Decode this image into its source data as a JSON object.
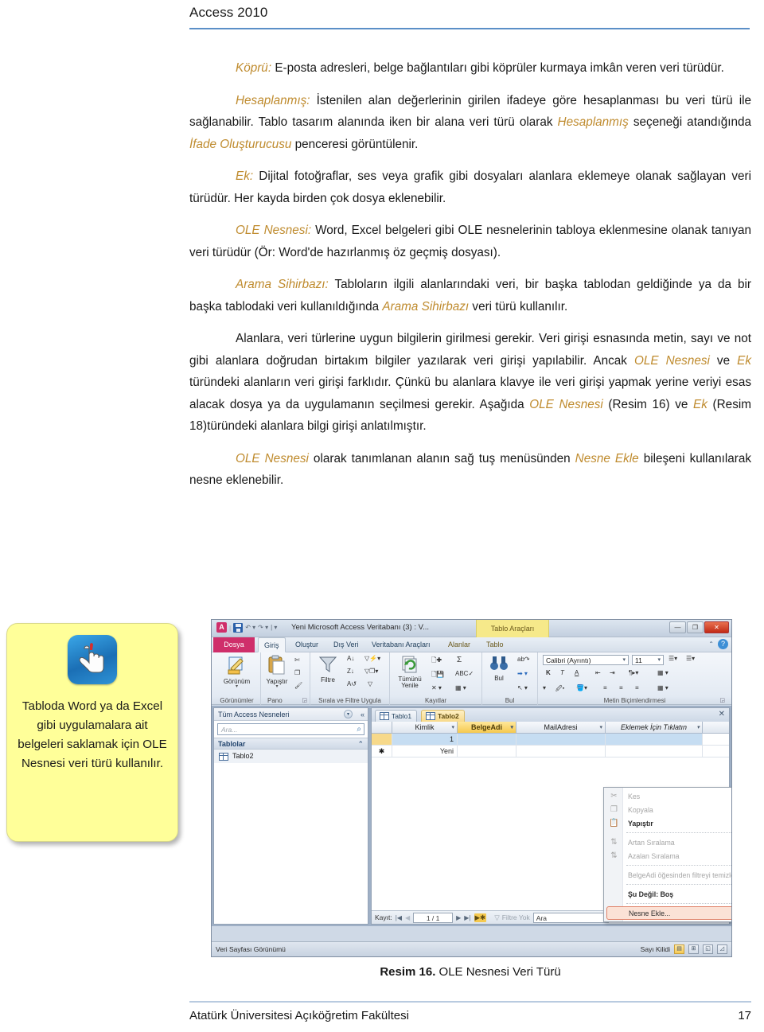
{
  "header": {
    "title": "Access 2010"
  },
  "colors": {
    "accent_text": "#bf8b2e",
    "rule": "#5b8fc7",
    "callout_bg": "#ffff99",
    "ribbon_file": "#cf2e6a",
    "context_tab": "#f6e98a"
  },
  "body_paragraphs": [
    {
      "lead": "Köprü:",
      "lead_style": "italic",
      "text": " E-posta adresleri, belge bağlantıları gibi köprüler kurmaya imkân veren veri türüdür."
    },
    {
      "lead": "Hesaplanmış:",
      "lead_style": "italic",
      "text": " İstenilen alan değerlerinin girilen ifadeye göre hesaplanması bu veri türü ile sağlanabilir. Tablo tasarım alanında iken bir alana veri türü olarak ",
      "mid1": "Hesaplanmış",
      "mid1_tail": " seçeneği atandığında ",
      "mid2": "İfade Oluşturucusu",
      "tail": " penceresi görüntülenir."
    },
    {
      "lead": "Ek:",
      "text": " Dijital fotoğraflar, ses veya grafik gibi dosyaları alanlara eklemeye olanak sağlayan veri türüdür. Her kayda birden çok dosya eklenebilir."
    },
    {
      "lead": "OLE Nesnesi:",
      "text": " Word, Excel belgeleri gibi OLE nesnelerinin tabloya eklenmesine olanak tanıyan veri türüdür (Ör: Word'de hazırlanmış öz geçmiş dosyası)."
    },
    {
      "lead": "Arama Sihirbazı:",
      "text": " Tabloların ilgili alanlarındaki veri, bir başka tablodan geldiğinde ya da bir başka tablodaki veri kullanıldığında ",
      "mid1": "Arama Sihirbazı",
      "tail": " veri türü kullanılır."
    }
  ],
  "paragraph6": {
    "p1": "Alanlara, veri türlerine uygun bilgilerin girilmesi gerekir. Veri girişi esnasında metin, sayı ve not gibi alanlara doğrudan birtakım bilgiler yazılarak veri girişi yapılabilir. Ancak ",
    "e1": "OLE Nesnesi",
    "p2": " ve ",
    "e2": "Ek",
    "p3": " türündeki alanların veri girişi farklıdır. Çünkü bu alanlara klavye ile veri girişi yapmak yerine veriyi esas alacak dosya ya da uygulamanın seçilmesi gerekir. Aşağıda ",
    "e3": "OLE Nesnesi",
    "p4": " (Resim 16) ve ",
    "e4": "Ek",
    "p5": " (Resim 18)türündeki alanlara bilgi girişi anlatılmıştır."
  },
  "paragraph7": {
    "e1": "OLE Nesnesi",
    "p1": " olarak tanımlanan alanın sağ tuş menüsünden ",
    "e2": "Nesne Ekle",
    "p2": " bileşeni kullanılarak nesne eklenebilir."
  },
  "callout": {
    "icon": "hand-pointer-icon",
    "text": "Tabloda Word ya da Excel gibi uygulamalara ait belgeleri saklamak için OLE Nesnesi veri türü kullanılır."
  },
  "access": {
    "titlebar": {
      "app_badge": "A",
      "document_title": "Yeni Microsoft Access Veritabanı (3) : V...",
      "contextual_tab_group": "Tablo Araçları",
      "minimize": "—",
      "maximize": "❐",
      "close": "✕"
    },
    "ribbon_tabs": {
      "file": "Dosya",
      "tabs": [
        "Giriş",
        "Oluştur",
        "Dış Veri",
        "Veritabanı Araçları"
      ],
      "contextual": [
        "Alanlar",
        "Tablo"
      ],
      "active": "Giriş",
      "help": "?"
    },
    "ribbon_groups": [
      {
        "label": "Görünümler",
        "big_button": "Görünüm",
        "icon": "view-design-icon"
      },
      {
        "label": "Pano",
        "big_button": "Yapıştır",
        "icon": "clipboard-icon",
        "small": [
          "Kes",
          "Kopyala",
          "Biçim Boyacısı"
        ]
      },
      {
        "label": "Sırala ve Filtre Uygula",
        "big_button": "Filtre",
        "icon": "funnel-icon",
        "small": [
          "A-Z Artan",
          "Z-A Azalan",
          "Sıralamayı Kaldır",
          "Seçim",
          "Gelişmiş",
          "Filtreyi Aç/Kapat"
        ]
      },
      {
        "label": "Kayıtlar",
        "big_button": "Tümünü Yenile",
        "icon": "refresh-icon",
        "small": [
          "Yeni",
          "Kaydet",
          "Toplamlar",
          "Sil",
          "Yazım Denetimi",
          "Diğer"
        ]
      },
      {
        "label": "Bul",
        "big_button": "Bul",
        "icon": "binoculars-icon",
        "small": [
          "Değiştir",
          "Git",
          "Seç"
        ]
      },
      {
        "label": "Metin Biçimlendirmesi",
        "font_name": "Calibri (Ayrıntı)",
        "font_size": "11",
        "small": [
          "K",
          "T",
          "A",
          "Vurgu",
          "Dolgu",
          "Sola",
          "Ortala",
          "Sağa",
          "Kılavuz"
        ]
      }
    ],
    "nav_pane": {
      "header": "Tüm Access Nesneleri",
      "search_placeholder": "Ara...",
      "group_header": "Tablolar",
      "items": [
        "Tablo2"
      ]
    },
    "datasheet": {
      "tabs": [
        {
          "label": "Tablo1",
          "active": false
        },
        {
          "label": "Tablo2",
          "active": true
        }
      ],
      "columns": [
        {
          "label": "Kimlik",
          "selected": false,
          "italic": false
        },
        {
          "label": "BelgeAdi",
          "selected": true,
          "italic": false
        },
        {
          "label": "MailAdresi",
          "selected": false,
          "italic": false
        },
        {
          "label": "Eklemek İçin Tıklatın",
          "selected": false,
          "italic": true
        }
      ],
      "rows": [
        {
          "marker": "",
          "cells": [
            "1",
            "",
            "",
            ""
          ]
        },
        {
          "marker": "✱",
          "cells": [
            "Yeni",
            "",
            "",
            ""
          ]
        }
      ]
    },
    "record_nav": {
      "label": "Kayıt:",
      "position": "1 / 1",
      "filter_label": "Filtre Yok",
      "search_value": "Ara"
    },
    "context_menu": {
      "items": [
        {
          "label": "Kes",
          "icon": "scissors-icon",
          "disabled": true,
          "separator_after": false
        },
        {
          "label": "Kopyala",
          "icon": "copy-icon",
          "disabled": true,
          "separator_after": false
        },
        {
          "label": "Yapıştır",
          "icon": "paste-icon",
          "disabled": false,
          "bold": true,
          "separator_after": true
        },
        {
          "label": "Artan Sıralama",
          "icon": "sort-az-icon",
          "disabled": true,
          "separator_after": false
        },
        {
          "label": "Azalan Sıralama",
          "icon": "sort-za-icon",
          "disabled": true,
          "separator_after": true
        },
        {
          "label": "BelgeAdi öğesinden filtreyi temizle",
          "icon": "",
          "disabled": true,
          "separator_after": true
        },
        {
          "label": "Şu Değil: Boş",
          "icon": "",
          "disabled": false,
          "bold": true,
          "separator_after": true
        },
        {
          "label": "Nesne Ekle...",
          "icon": "",
          "disabled": false,
          "highlighted": true,
          "separator_after": false
        }
      ]
    },
    "status_bar": {
      "view_label": "Veri Sayfası Görünümü",
      "lock_label": "Sayı Kilidi",
      "view_buttons": [
        "datasheet-view",
        "pivottable-view",
        "pivotchart-view",
        "design-view"
      ]
    }
  },
  "caption": {
    "bold": "Resim 16.",
    "text": " OLE Nesnesi Veri Türü"
  },
  "footer": {
    "institution": "Atatürk Üniversitesi Açıköğretim Fakültesi",
    "page": "17"
  }
}
